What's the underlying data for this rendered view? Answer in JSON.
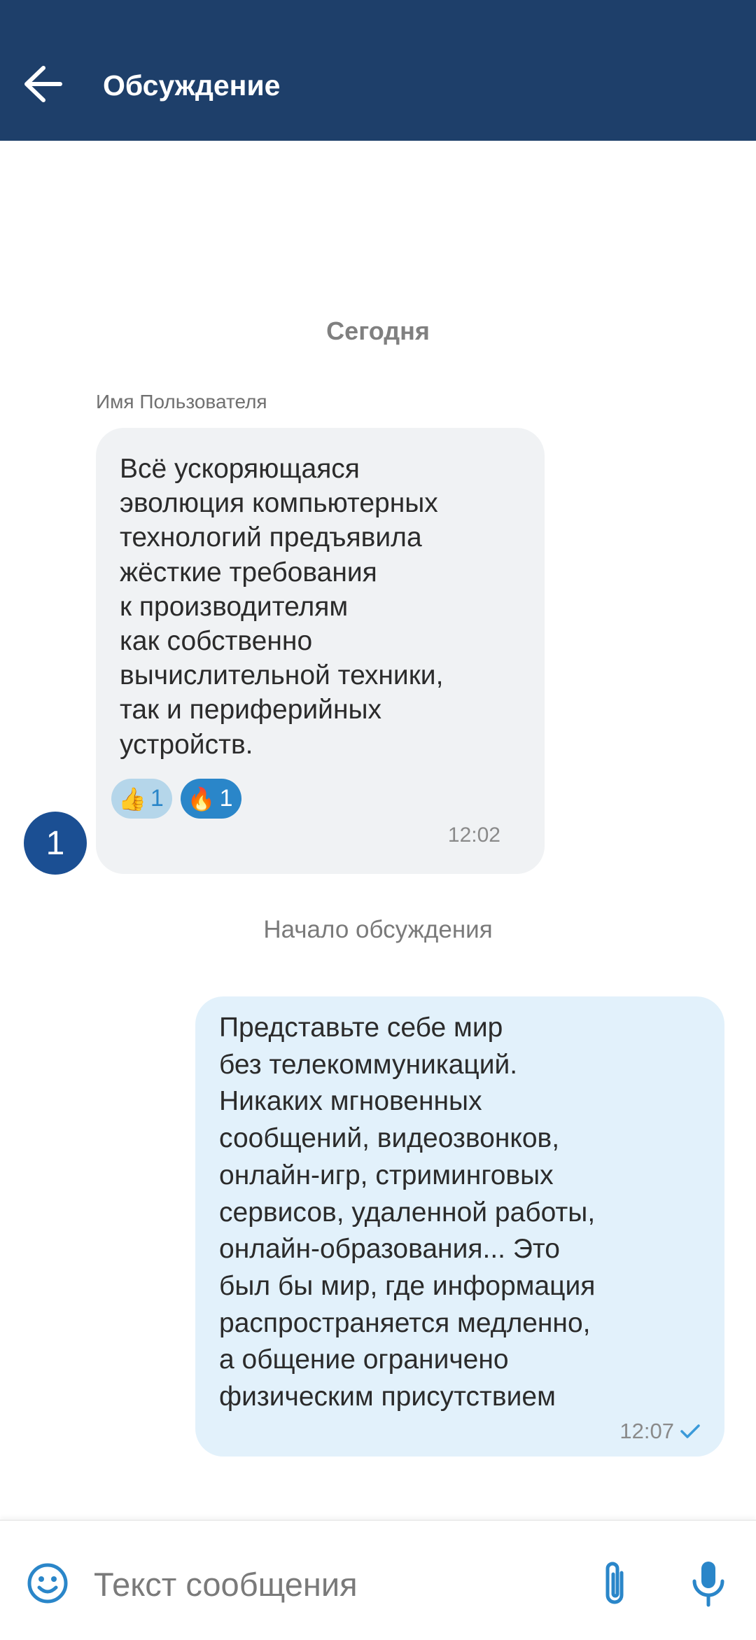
{
  "header": {
    "title": "Обсуждение",
    "back_icon": "arrow-left-icon"
  },
  "feed": {
    "date_separator": "Сегодня",
    "incoming": {
      "sender": "Имя Пользователя",
      "text": "Всё ускоряющаяся\nэволюция компьютерных\nтехнологий предъявила\nжёсткие требования\nк производителям\nкак собственно\nвычислительной техники,\nтак и периферийных\nустройств.",
      "reactions": [
        {
          "emoji": "👍",
          "count": "1",
          "icon": "thumbs-up-icon",
          "active": false
        },
        {
          "emoji": "🔥",
          "count": "1",
          "icon": "fire-icon",
          "active": true
        }
      ],
      "time": "12:02",
      "avatar_badge": "1"
    },
    "thread_start_label": "Начало обсуждения",
    "outgoing": {
      "text": "Представьте себе мир\nбез телекоммуникаций.\nНикаких мгновенных\nсообщений, видеозвонков,\nонлайн-игр, стриминговых\nсервисов, удаленной работы,\nонлайн-образования... Это\nбыл бы мир, где информация\nраспространяется медленно,\nа общение ограничено\nфизическим присутствием",
      "time": "12:07",
      "status_icon": "check-icon"
    }
  },
  "composer": {
    "placeholder": "Текст сообщения",
    "value": "",
    "icons": [
      "smiley-icon",
      "paperclip-icon",
      "microphone-icon"
    ]
  },
  "colors": {
    "header_bg": "#1e3f6a",
    "accent": "#2a86c9",
    "incoming_bubble": "#f0f2f4",
    "outgoing_bubble": "#e2f1fb",
    "avatar": "#1b4f93"
  }
}
